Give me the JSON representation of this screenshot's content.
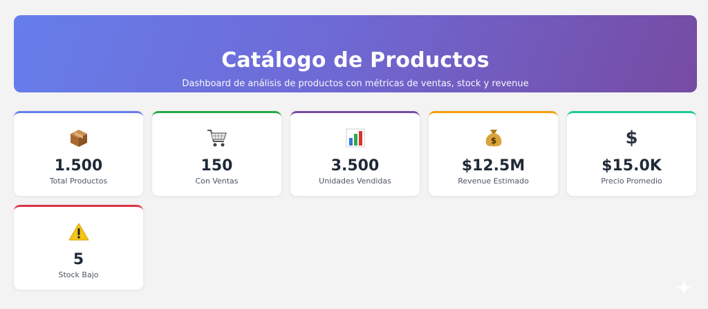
{
  "header": {
    "title": "Catálogo de Productos",
    "subtitle": "Dashboard de análisis de productos con métricas de ventas, stock y revenue"
  },
  "stats": [
    {
      "icon": "package-icon",
      "value": "1.500",
      "label": "Total Productos",
      "accent": "#667eea"
    },
    {
      "icon": "shopping-cart-icon",
      "value": "150",
      "label": "Con Ventas",
      "accent": "#28a745"
    },
    {
      "icon": "bar-chart-icon",
      "value": "3.500",
      "label": "Unidades Vendidas",
      "accent": "#764ba2"
    },
    {
      "icon": "money-bag-icon",
      "value": "$12.5M",
      "label": "Revenue Estimado",
      "accent": "#f59e0b"
    },
    {
      "icon": "dollar-icon",
      "value": "$15.0K",
      "label": "Precio Promedio",
      "accent": "#20c997"
    },
    {
      "icon": "warning-icon",
      "value": "5",
      "label": "Stock Bajo",
      "accent": "#dc3545"
    }
  ]
}
